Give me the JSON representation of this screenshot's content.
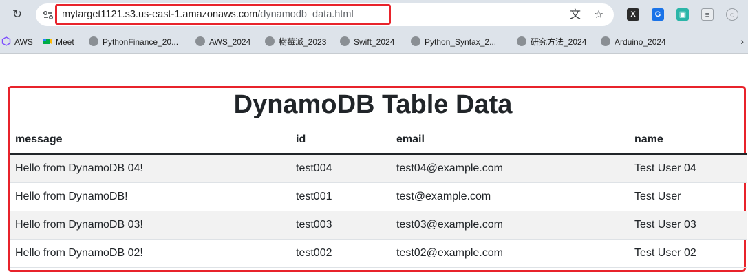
{
  "browser": {
    "url_host": "mytarget1121.s3.us-east-1.amazonaws.com",
    "url_path": "/dynamodb_data.html",
    "bookmarks": [
      {
        "label": "AWS"
      },
      {
        "label": "Meet"
      },
      {
        "label": "PythonFinance_20..."
      },
      {
        "label": "AWS_2024"
      },
      {
        "label": "樹莓派_2023"
      },
      {
        "label": "Swift_2024"
      },
      {
        "label": "Python_Syntax_2..."
      },
      {
        "label": "研究方法_2024"
      },
      {
        "label": "Arduino_2024"
      }
    ],
    "icons": {
      "reload": "reload-icon",
      "site_info": "site-info-icon",
      "translate": "translate-icon",
      "bookmark_star": "star-icon",
      "overflow": "chevron-right-icon"
    }
  },
  "page": {
    "title": "DynamoDB Table Data",
    "table": {
      "headers": [
        "message",
        "id",
        "email",
        "name"
      ],
      "rows": [
        [
          "Hello from DynamoDB 04!",
          "test004",
          "test04@example.com",
          "Test User 04"
        ],
        [
          "Hello from DynamoDB!",
          "test001",
          "test@example.com",
          "Test User"
        ],
        [
          "Hello from DynamoDB 03!",
          "test003",
          "test03@example.com",
          "Test User 03"
        ],
        [
          "Hello from DynamoDB 02!",
          "test002",
          "test02@example.com",
          "Test User 02"
        ]
      ]
    }
  },
  "colors": {
    "highlight": "#e8232b",
    "chrome": "#dde3ea",
    "stripe": "#f2f2f2"
  }
}
